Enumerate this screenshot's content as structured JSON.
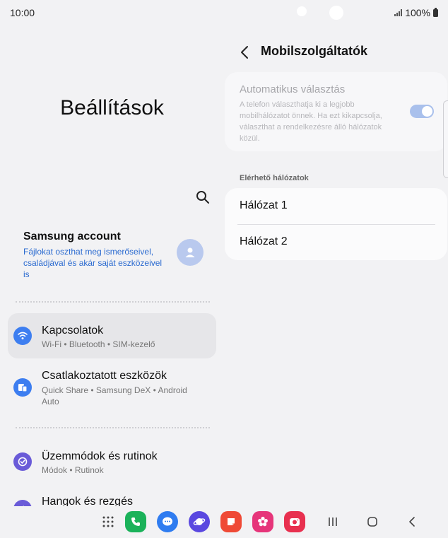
{
  "status_bar": {
    "time": "10:00",
    "battery": "100%"
  },
  "left_panel": {
    "title": "Beállítások",
    "account": {
      "title": "Samsung account",
      "description": "Fájlokat oszthat meg ismerőseivel, családjával és akár saját eszközeivel is"
    },
    "items": [
      {
        "title": "Kapcsolatok",
        "subtitle": "Wi-Fi • Bluetooth • SIM-kezelő",
        "icon": "wifi-icon",
        "color": "#3d7ef0",
        "selected": true
      },
      {
        "title": "Csatlakoztatott eszközök",
        "subtitle": "Quick Share • Samsung DeX • Android Auto",
        "icon": "connected-devices-icon",
        "color": "#3d7ef0"
      },
      {
        "title": "Üzemmódok és rutinok",
        "subtitle": "Módok • Rutinok",
        "icon": "modes-icon",
        "color": "#6a5bd8"
      },
      {
        "title": "Hangok és rezgés",
        "subtitle": "",
        "icon": "sound-icon",
        "color": "#6a5bd8"
      }
    ]
  },
  "right_panel": {
    "title": "Mobilszolgáltatók",
    "auto_select": {
      "title": "Automatikus választás",
      "description": "A telefon választhatja ki a legjobb mobilhálózatot önnek. Ha ezt kikapcsolja, választhat a rendelkezésre álló hálózatok közül.",
      "enabled": true
    },
    "section_header": "Elérhető hálózatok",
    "networks": [
      "Hálózat 1",
      "Hálózat 2"
    ]
  },
  "dock": {
    "apps": [
      {
        "name": "apps-grid-icon"
      },
      {
        "name": "phone-app-icon",
        "color": "#1bb25a"
      },
      {
        "name": "messages-app-icon",
        "color": "#2f7cf0"
      },
      {
        "name": "internet-app-icon",
        "color": "#5a48e0"
      },
      {
        "name": "notes-app-icon",
        "color": "#ef4a36"
      },
      {
        "name": "gallery-app-icon",
        "color": "#e6357a"
      },
      {
        "name": "camera-app-icon",
        "color": "#e8304f"
      }
    ]
  }
}
